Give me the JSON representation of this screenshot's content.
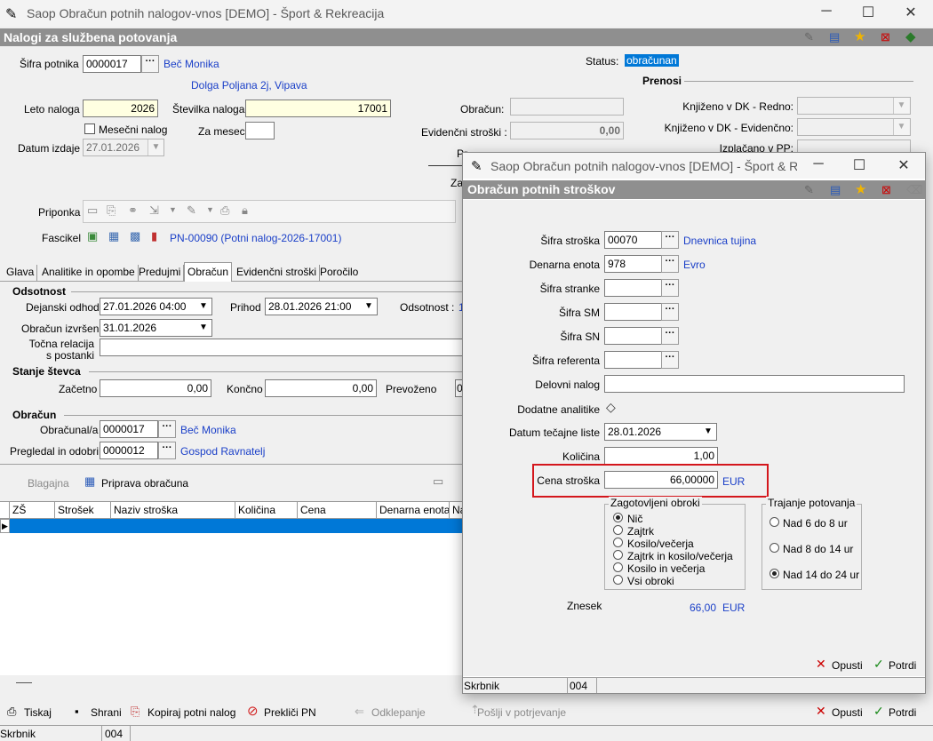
{
  "main": {
    "window_title": "Saop Obračun potnih nalogov-vnos [DEMO] - Šport & Rekreacija",
    "caption": "Nalogi za službena potovanja",
    "sifra_potnika_label": "Šifra potnika",
    "sifra_potnika": "0000017",
    "potnik_name": "Beč Monika",
    "potnik_address": "Dolga Poljana 2j, Vipava",
    "status_label": "Status:",
    "status_value": "obračunan",
    "leto_label": "Leto naloga",
    "leto": "2026",
    "stevilka_label": "Številka naloga",
    "stevilka": "17001",
    "mesecni_label": "Mesečni nalog",
    "za_mesec_label": "Za mesec",
    "datum_izdaje_label": "Datum izdaje",
    "datum_izdaje": "27.01.2026",
    "obracun_label": "Obračun:",
    "evid_label": "Evidenčni stroški :",
    "evid_value": "0,00",
    "partial_pr": "Pr",
    "partial_za": "Za",
    "prenosi_title": "Prenosi",
    "knj_redno_label": "Knjiženo v DK - Redno:",
    "knj_evid_label": "Knjiženo v DK - Evidenčno:",
    "izplacano_label": "Izplačano v PP:",
    "priponka_label": "Priponka",
    "fascikel_label": "Fascikel",
    "fascikel_link": "PN-00090 (Potni nalog-2026-17001)",
    "tabs": [
      "Glava",
      "Analitike in opombe",
      "Predujmi",
      "Obračun",
      "Evidenčni stroški",
      "Poročilo"
    ],
    "odsotnost_title": "Odsotnost",
    "dejanski_odhod_label": "Dejanski odhod",
    "dejanski_odhod": "27.01.2026 04:00",
    "prihod_label": "Prihod",
    "prihod": "28.01.2026 21:00",
    "odsotnost_label": "Odsotnost :",
    "odsotnost_partial": "1",
    "obracun_izvrsen_label": "Obračun izvršen",
    "obracun_izvrsen": "31.01.2026",
    "tocna_relacija_label1": "Točna relacija",
    "tocna_relacija_label2": "s postanki",
    "stanje_title": "Stanje števca",
    "zacetno_label": "Začetno",
    "zacetno": "0,00",
    "koncno_label": "Končno",
    "koncno": "0,00",
    "prevozeno_label": "Prevoženo",
    "prevozeno_partial": "0",
    "obracun_group_title": "Obračun",
    "obracunal_label": "Obračunal/a",
    "obracunal": "0000017",
    "obracunal_name": "Beč Monika",
    "pregledal_label": "Pregledal in odobril",
    "pregledal": "0000012",
    "pregledal_name": "Gospod Ravnatelj",
    "blagajna": "Blagajna",
    "priprava": "Priprava obračuna",
    "grid_headers": [
      "ZŠ",
      "Strošek",
      "Naziv stroška",
      "Količina",
      "Cena",
      "Denarna enota",
      "Na"
    ],
    "bottom_buttons": [
      "Tiskaj",
      "Shrani",
      "Kopiraj potni nalog",
      "Prekliči PN",
      "Odklepanje",
      "Pošlji v potrjevanje"
    ],
    "opusti": "Opusti",
    "potrdi": "Potrdi",
    "status_skrbnik": "Skrbnik",
    "status_code": "004"
  },
  "dialog": {
    "window_title": "Saop Obračun potnih nalogov-vnos [DEMO] - Šport & Rek...",
    "caption": "Obračun potnih stroškov",
    "sifra_stroska_label": "Šifra stroška",
    "sifra_stroska": "00070",
    "sifra_stroska_name": "Dnevnica tujina",
    "denarna_enota_label": "Denarna enota",
    "denarna_enota": "978",
    "denarna_enota_name": "Evro",
    "sifra_stranke_label": "Šifra stranke",
    "sifra_sm_label": "Šifra SM",
    "sifra_sn_label": "Šifra SN",
    "sifra_referenta_label": "Šifra referenta",
    "delovni_nalog_label": "Delovni nalog",
    "dodatne_label": "Dodatne analitike",
    "datum_tecajne_label": "Datum tečajne liste",
    "datum_tecajne": "28.01.2026",
    "kolicina_label": "Količina",
    "kolicina": "1,00",
    "cena_label": "Cena stroška",
    "cena": "66,00000",
    "cena_unit": "EUR",
    "obroki_title": "Zagotovljeni obroki",
    "obroki": [
      "Nič",
      "Zajtrk",
      "Kosilo/večerja",
      "Zajtrk in kosilo/večerja",
      "Kosilo in večerja",
      "Vsi obroki"
    ],
    "trajanje_title": "Trajanje potovanja",
    "trajanje": [
      "Nad 6 do 8 ur",
      "Nad 8 do 14 ur",
      "Nad 14 do 24 ur"
    ],
    "znesek_label": "Znesek",
    "znesek": "66,00",
    "znesek_unit": "EUR",
    "opusti": "Opusti",
    "potrdi": "Potrdi",
    "status_skrbnik": "Skrbnik",
    "status_code": "004"
  },
  "colors": {
    "caption_bg": "#8f8f8f",
    "highlight": "#d4161c",
    "link": "#1a3fc8",
    "selected_row": "#0078d7"
  }
}
